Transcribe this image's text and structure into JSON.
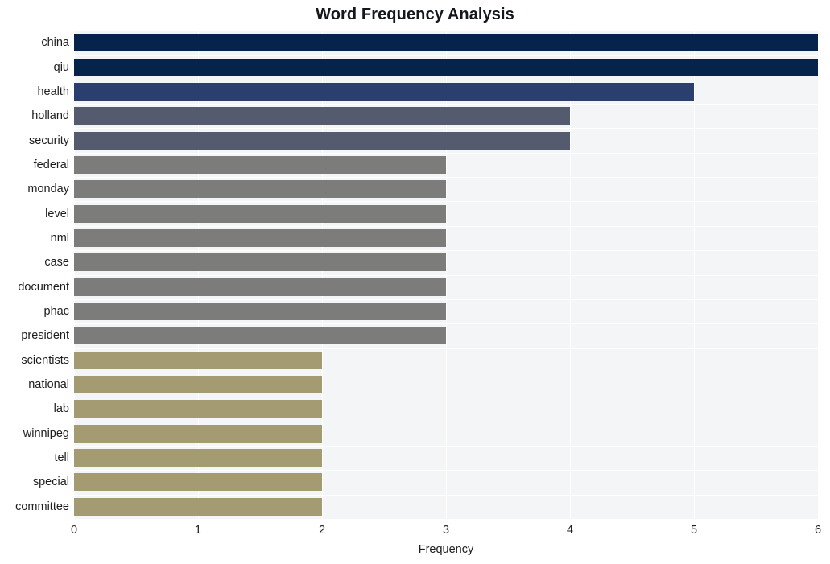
{
  "chart_data": {
    "type": "bar",
    "orientation": "horizontal",
    "title": "Word Frequency Analysis",
    "xlabel": "Frequency",
    "ylabel": "",
    "xlim": [
      0,
      6
    ],
    "ylim": [
      0,
      20
    ],
    "xticks": [
      "0",
      "1",
      "2",
      "3",
      "4",
      "5",
      "6"
    ],
    "xtick_values": [
      0,
      1,
      2,
      3,
      4,
      5,
      6
    ],
    "grid": true,
    "grid_color": "#ffffff",
    "legend": false,
    "plot_background": "#f4f5f6",
    "figure_background": "#ffffff",
    "categories": [
      "china",
      "qiu",
      "health",
      "holland",
      "security",
      "federal",
      "monday",
      "level",
      "nml",
      "case",
      "document",
      "phac",
      "president",
      "scientists",
      "national",
      "lab",
      "winnipeg",
      "tell",
      "special",
      "committee"
    ],
    "values": [
      6,
      6,
      5,
      4,
      4,
      3,
      3,
      3,
      3,
      3,
      3,
      3,
      3,
      2,
      2,
      2,
      2,
      2,
      2,
      2
    ],
    "bar_colors": [
      "#06234c",
      "#06234c",
      "#2a3f6e",
      "#555b6e",
      "#555b6e",
      "#7c7c7a",
      "#7c7c7a",
      "#7c7c7a",
      "#7c7c7a",
      "#7c7c7a",
      "#7c7c7a",
      "#7c7c7a",
      "#7c7c7a",
      "#a59b72",
      "#a59b72",
      "#a59b72",
      "#a59b72",
      "#a59b72",
      "#a59b72",
      "#a59b72"
    ]
  }
}
